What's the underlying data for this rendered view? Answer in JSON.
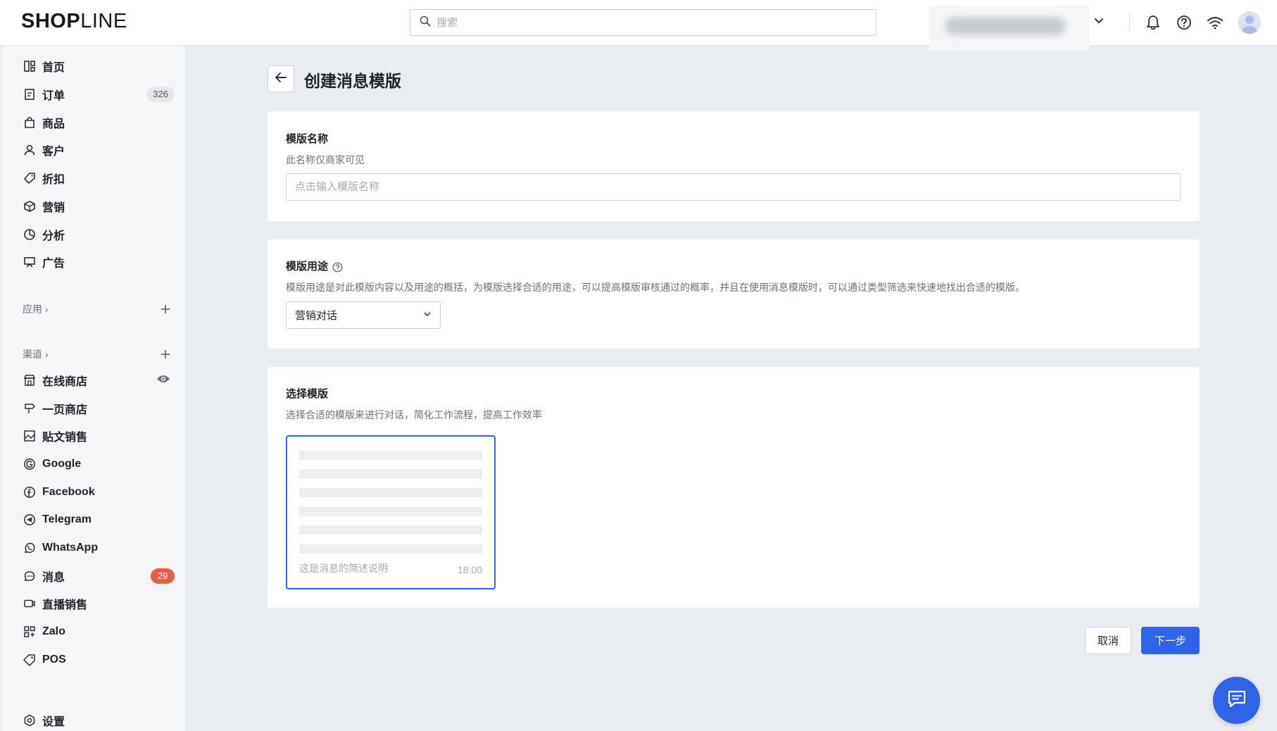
{
  "brand": {
    "logo_text_bold": "SHOPLINE",
    "logo_bold": "SH",
    "logo_o": "O",
    "logo_p": "P",
    "logo_light": "LINE"
  },
  "search": {
    "placeholder": "搜索"
  },
  "colors": {
    "primary": "#2f63e8",
    "badge_red": "#ec5b47",
    "sidebar_bg": "#f5f6f8",
    "page_bg": "#e9ecf1"
  },
  "header_icons": [
    "chevron-down-icon",
    "bell-icon",
    "help-icon",
    "wifi-icon",
    "avatar"
  ],
  "sidebar": {
    "items": [
      {
        "label": "首页",
        "icon": "dashboard-icon"
      },
      {
        "label": "订单",
        "icon": "order-icon",
        "badge": "326"
      },
      {
        "label": "商品",
        "icon": "bag-icon"
      },
      {
        "label": "客户",
        "icon": "user-icon"
      },
      {
        "label": "折扣",
        "icon": "tag-icon"
      },
      {
        "label": "营销",
        "icon": "box-icon"
      },
      {
        "label": "分析",
        "icon": "pie-chart-icon"
      },
      {
        "label": "广告",
        "icon": "ad-board-icon"
      }
    ],
    "apps_label": "应用",
    "channels_label": "渠道",
    "channels": [
      {
        "label": "在线商店",
        "icon": "store-icon",
        "extra": "eye-icon"
      },
      {
        "label": "一页商店",
        "icon": "signpost-icon"
      },
      {
        "label": "贴文销售",
        "icon": "image-post-icon"
      },
      {
        "label": "Google",
        "icon": "google-icon"
      },
      {
        "label": "Facebook",
        "icon": "facebook-icon"
      },
      {
        "label": "Telegram",
        "icon": "telegram-icon"
      },
      {
        "label": "WhatsApp",
        "icon": "whatsapp-icon"
      },
      {
        "label": "消息",
        "icon": "message-icon",
        "badge": "29"
      },
      {
        "label": "直播销售",
        "icon": "live-icon"
      },
      {
        "label": "Zalo",
        "icon": "zalo-icon"
      },
      {
        "label": "POS",
        "icon": "pos-icon"
      }
    ],
    "settings_label": "设置"
  },
  "page": {
    "title": "创建消息模版"
  },
  "name_section": {
    "title": "模版名称",
    "description": "此名称仅商家可见",
    "placeholder": "点击输入模版名称",
    "value": ""
  },
  "usage_section": {
    "title": "模版用途",
    "description": "模版用途是对此模版内容以及用途的概括，为模版选择合适的用途，可以提高模版审核通过的概率，并且在使用消息模版时，可以通过类型筛选来快速地找出合适的模版。",
    "selected": "营销对话"
  },
  "template_section": {
    "title": "选择模版",
    "description": "选择合适的模版来进行对话，简化工作流程，提高工作效率",
    "preview_lines": 6,
    "preview_desc": "这是消息的简述说明",
    "preview_time": "18:00"
  },
  "actions": {
    "cancel": "取消",
    "next": "下一步"
  }
}
